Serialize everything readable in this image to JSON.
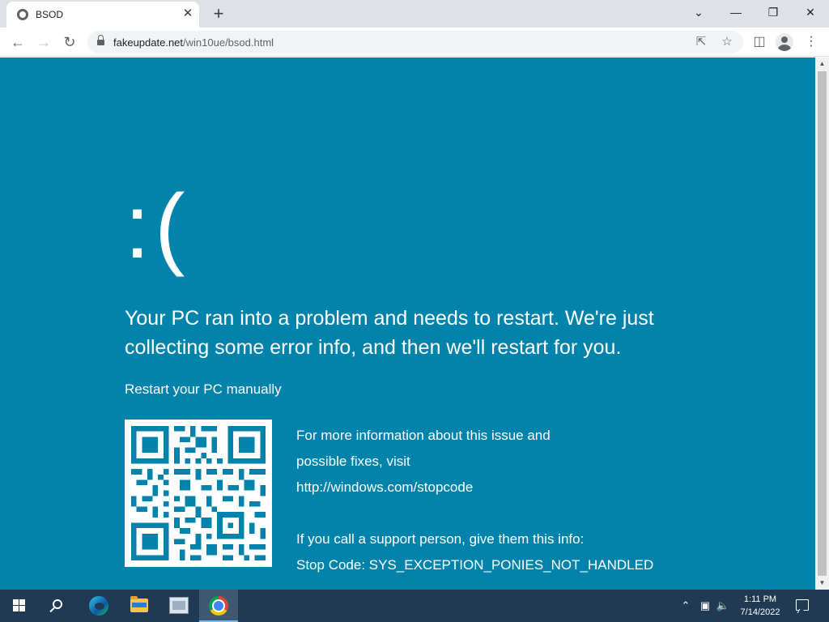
{
  "browser": {
    "tab": {
      "title": "BSOD",
      "close_glyph": "✕"
    },
    "new_tab_glyph": "+",
    "window_controls": {
      "dropdown": "⌄",
      "minimize": "—",
      "restore": "❐",
      "close": "✕"
    },
    "address_bar": {
      "domain": "fakeupdate.net",
      "path": "/win10ue/bsod.html"
    },
    "icons": [
      "back-icon",
      "forward-icon",
      "reload-icon",
      "lock-icon",
      "share-icon",
      "star-icon",
      "side-panel-icon",
      "profile-icon",
      "menu-icon"
    ]
  },
  "page": {
    "sad_face": ":(",
    "headline": "Your PC ran into a problem and needs to restart. We're just collecting some error info, and then we'll restart for you.",
    "restart_manually": "Restart your PC manually",
    "info_line_1": "For more information about this issue and",
    "info_line_2": "possible fixes, visit",
    "info_link": "http://windows.com/stopcode",
    "support_line": "If you call a support person, give them this info:",
    "stop_code": "Stop Code: SYS_EXCEPTION_PONIES_NOT_HANDLED",
    "background_color": "#0183ab"
  },
  "taskbar": {
    "apps": [
      "windows-start",
      "search",
      "edge",
      "file-explorer",
      "app",
      "chrome"
    ],
    "active_app": "chrome",
    "clock_time": "1:11 PM",
    "clock_date": "7/14/2022",
    "color": "#1f3a52"
  }
}
